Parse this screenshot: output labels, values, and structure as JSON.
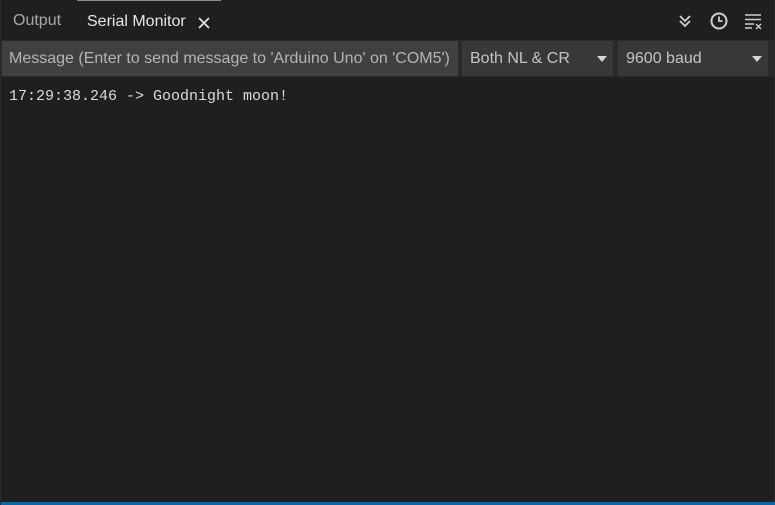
{
  "tabs": {
    "output_label": "Output",
    "serial_label": "Serial Monitor"
  },
  "toolbar_icons": [
    "double-chevron-down-icon",
    "clock-icon",
    "clear-output-icon"
  ],
  "message": {
    "placeholder": "Message (Enter to send message to 'Arduino Uno' on 'COM5')",
    "value": ""
  },
  "line_ending": {
    "selected": "Both NL & CR"
  },
  "baud_rate": {
    "selected": "9600 baud"
  },
  "output": {
    "lines": [
      "17:29:38.246 -> Goodnight moon!"
    ]
  },
  "colors": {
    "background": "#1f1f1f",
    "accent_bar": "#0b68a8"
  }
}
